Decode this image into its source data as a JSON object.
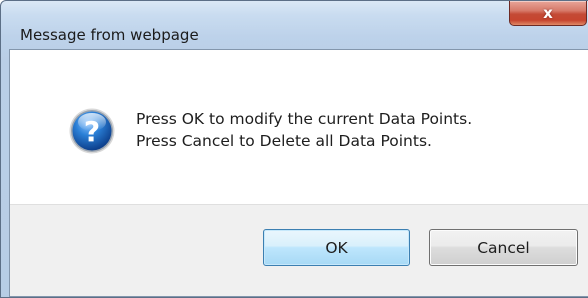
{
  "window": {
    "title": "Message from webpage",
    "close_glyph": "x"
  },
  "message": {
    "icon": "question-icon",
    "lines": [
      "Press OK to modify the current Data Points.",
      "Press Cancel to Delete all Data Points."
    ]
  },
  "buttons": {
    "ok_label": "OK",
    "cancel_label": "Cancel"
  },
  "colors": {
    "icon_blue": "#1f6fc1",
    "ok_border": "#3c7fb1",
    "close_red": "#c44a36"
  }
}
